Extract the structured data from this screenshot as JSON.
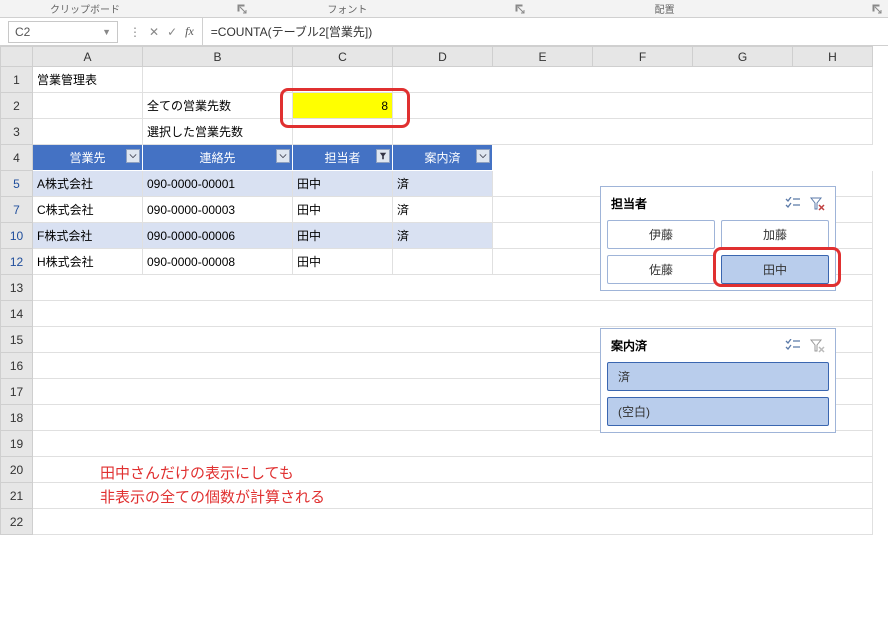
{
  "ribbon": {
    "tab_clipboard": "クリップボード",
    "tab_font": "フォント",
    "tab_align": "配置"
  },
  "formula_bar": {
    "name_box": "C2",
    "formula": "=COUNTA(テーブル2[営業先])"
  },
  "columns": [
    "A",
    "B",
    "C",
    "D",
    "E",
    "F",
    "G",
    "H"
  ],
  "rows_visible": [
    "1",
    "2",
    "3",
    "4",
    "5",
    "7",
    "10",
    "12",
    "13",
    "14",
    "15",
    "16",
    "17",
    "18",
    "19",
    "20",
    "21",
    "22"
  ],
  "cells": {
    "A1": "営業管理表",
    "B2": "全ての営業先数",
    "C2": "8",
    "B3": "選択した営業先数"
  },
  "table": {
    "headers": [
      "営業先",
      "連絡先",
      "担当者",
      "案内済"
    ],
    "rows": [
      {
        "n": "5",
        "v": [
          "A株式会社",
          "090-0000-00001",
          "田中",
          "済"
        ],
        "alt": true
      },
      {
        "n": "7",
        "v": [
          "C株式会社",
          "090-0000-00003",
          "田中",
          "済"
        ],
        "alt": false
      },
      {
        "n": "10",
        "v": [
          "F株式会社",
          "090-0000-00006",
          "田中",
          "済"
        ],
        "alt": true
      },
      {
        "n": "12",
        "v": [
          "H株式会社",
          "090-0000-00008",
          "田中",
          ""
        ],
        "alt": false
      }
    ]
  },
  "annotation": {
    "line1": "田中さんだけの表示にしても",
    "line2": "非表示の全ての個数が計算される"
  },
  "slicer1": {
    "title": "担当者",
    "items": [
      {
        "label": "伊藤",
        "sel": false
      },
      {
        "label": "加藤",
        "sel": false
      },
      {
        "label": "佐藤",
        "sel": false
      },
      {
        "label": "田中",
        "sel": true
      }
    ]
  },
  "slicer2": {
    "title": "案内済",
    "items": [
      {
        "label": "済",
        "sel": true
      },
      {
        "label": "(空白)",
        "sel": true
      }
    ]
  }
}
